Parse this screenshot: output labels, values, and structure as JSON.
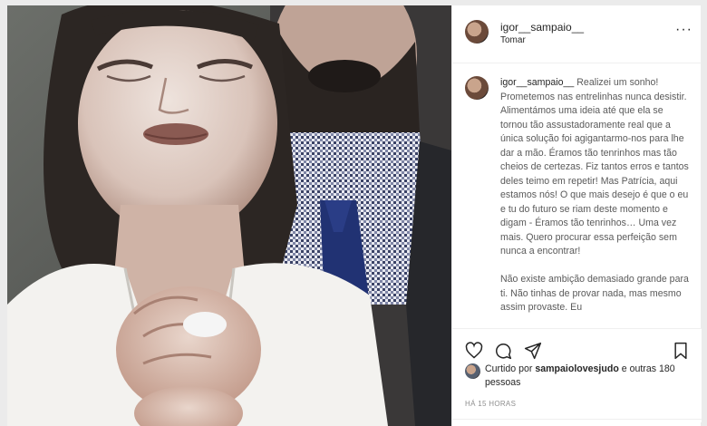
{
  "post": {
    "username": "igor__sampaio__",
    "location": "Tomar",
    "more_label": "···",
    "caption_user": "igor__sampaio__",
    "caption_p1": "Realizei um sonho! Prometemos nas entrelinhas nunca desistir. Alimentámos uma ideia até que ela se tornou tão assustadoramente real que a única solução foi agigantarmo-nos para lhe dar a mão. Éramos tão tenrinhos mas tão cheios de certezas. Fiz tantos erros e tantos deles teimo em repetir! Mas Patrícia, aqui estamos nós! O que mais desejo é que o eu e tu do futuro se riam deste momento e digam - Éramos tão tenrinhos… Uma vez mais. Quero procurar essa perfeição sem nunca a encontrar!",
    "caption_p2": "Não existe ambição demasiado grande para ti. Não tinhas de provar nada, mas mesmo assim provaste. Eu",
    "likes_prefix": "Curtido por ",
    "likes_user": "sampaiolovesjudo",
    "likes_suffix": " e outras 180 pessoas",
    "time": "HÁ 15 HORAS"
  },
  "icons": {
    "like": "heart-icon",
    "comment": "comment-icon",
    "share": "share-icon",
    "save": "bookmark-icon",
    "more": "more-horizontal-icon"
  },
  "colors": {
    "text": "#262626",
    "caption_text": "#5a5a5a",
    "muted": "#8e8e8e",
    "border": "#efefef"
  }
}
